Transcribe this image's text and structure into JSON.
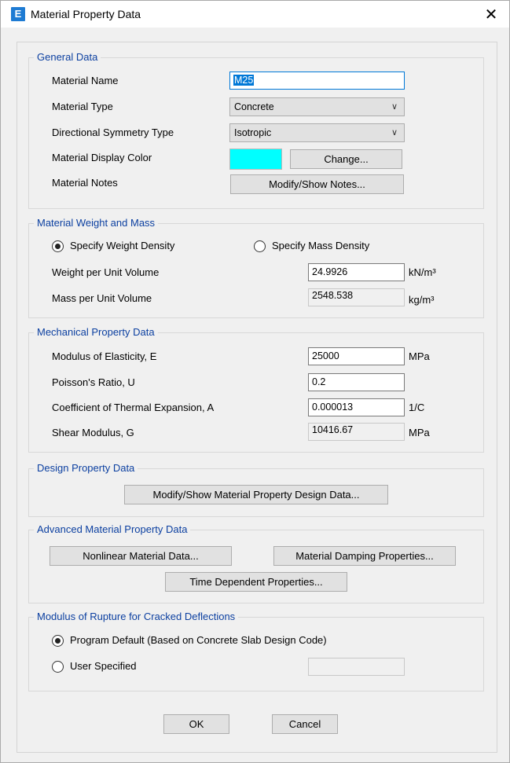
{
  "window": {
    "title": "Material Property Data",
    "app_icon_letter": "E",
    "close_glyph": "✕"
  },
  "general": {
    "heading": "General Data",
    "material_name_label": "Material Name",
    "material_name_value": "M25",
    "material_type_label": "Material Type",
    "material_type_value": "Concrete",
    "symmetry_label": "Directional Symmetry Type",
    "symmetry_value": "Isotropic",
    "display_color_label": "Material Display Color",
    "display_color": "#00ffff",
    "change_button": "Change...",
    "notes_label": "Material Notes",
    "notes_button": "Modify/Show Notes..."
  },
  "weight_mass": {
    "heading": "Material Weight and Mass",
    "radio_weight": "Specify Weight Density",
    "radio_mass": "Specify Mass Density",
    "selected": "weight",
    "weight_label": "Weight per Unit Volume",
    "weight_value": "24.9926",
    "weight_unit": "kN/m³",
    "mass_label": "Mass per Unit Volume",
    "mass_value": "2548.538",
    "mass_unit": "kg/m³"
  },
  "mechanical": {
    "heading": "Mechanical Property Data",
    "e_label": "Modulus of Elasticity,  E",
    "e_value": "25000",
    "e_unit": "MPa",
    "u_label": "Poisson's Ratio,  U",
    "u_value": "0.2",
    "a_label": "Coefficient of Thermal Expansion,  A",
    "a_value": "0.000013",
    "a_unit": "1/C",
    "g_label": "Shear Modulus,  G",
    "g_value": "10416.67",
    "g_unit": "MPa"
  },
  "design": {
    "heading": "Design Property Data",
    "button": "Modify/Show Material Property Design Data..."
  },
  "advanced": {
    "heading": "Advanced Material Property Data",
    "nonlinear_button": "Nonlinear Material Data...",
    "damping_button": "Material Damping Properties...",
    "time_button": "Time Dependent Properties..."
  },
  "rupture": {
    "heading": "Modulus of Rupture for Cracked Deflections",
    "radio_default": "Program Default  (Based on Concrete Slab Design Code)",
    "radio_user": "User Specified",
    "selected": "default",
    "user_value": ""
  },
  "footer": {
    "ok": "OK",
    "cancel": "Cancel"
  },
  "icons": {
    "chevron": "⌵"
  }
}
